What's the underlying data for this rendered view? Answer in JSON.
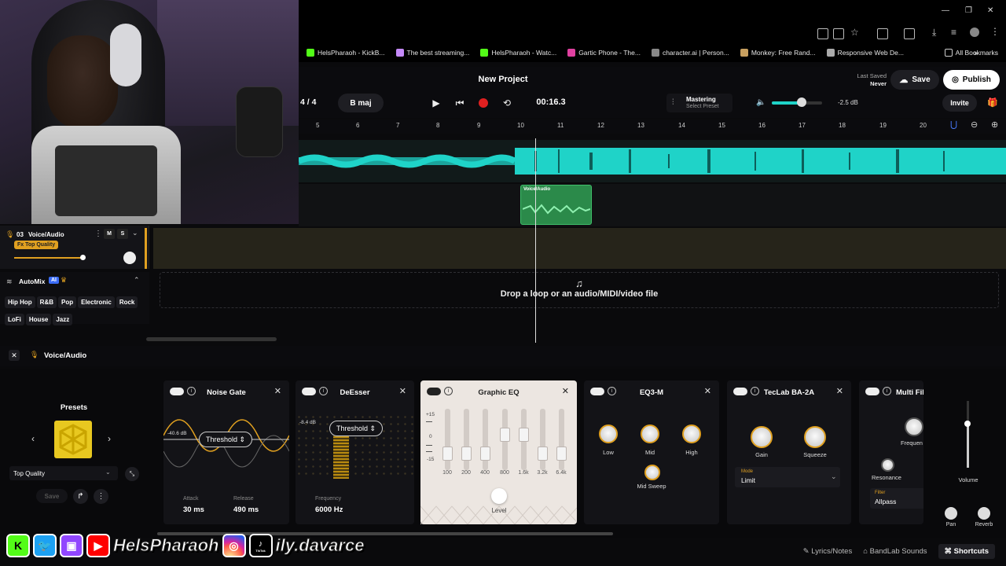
{
  "browser": {
    "bookmarks": [
      {
        "label": "HelsPharaoh - KickB...",
        "color": "#53fc18"
      },
      {
        "label": "The best streaming...",
        "color": "#c58af9"
      },
      {
        "label": "HelsPharaoh - Watc...",
        "color": "#53fc18"
      },
      {
        "label": "Gartic Phone - The...",
        "color": "#e040a0"
      },
      {
        "label": "character.ai | Person...",
        "color": "#888888"
      },
      {
        "label": "Monkey: Free Rand...",
        "color": "#c8a060"
      },
      {
        "label": "Responsive Web De...",
        "color": "#aaaaaa"
      }
    ],
    "all_bookmarks": "All Bookmarks"
  },
  "header": {
    "project_title": "New Project",
    "last_saved_label": "Last Saved",
    "last_saved_value": "Never",
    "save_label": "Save",
    "publish_label": "Publish",
    "invite_label": "Invite",
    "time_signature": "4 / 4",
    "key": "B maj",
    "time": "00:16.3",
    "mastering_label": "Mastering",
    "mastering_preset": "Select Preset",
    "volume_db": "-2.5 dB"
  },
  "ruler": [
    "5",
    "6",
    "7",
    "8",
    "9",
    "10",
    "11",
    "12",
    "13",
    "14",
    "15",
    "16",
    "17",
    "18",
    "19",
    "20"
  ],
  "track": {
    "number": "03",
    "name": "Voice/Audio",
    "mute": "M",
    "solo": "S",
    "fx_badge": "Fx Top Quality",
    "clip_label": "Voice/Audio"
  },
  "automix": {
    "title": "AutoMix",
    "ai_badge": "AI",
    "genres_row1": [
      "Hip Hop",
      "R&B",
      "Pop",
      "Electronic",
      "Rock"
    ],
    "genres_row2": [
      "LoFi",
      "House",
      "Jazz"
    ]
  },
  "drop_zone": "Drop a loop or an audio/MIDI/video file",
  "fx_panel": {
    "track_name": "Voice/Audio",
    "presets_title": "Presets",
    "preset_value": "Top Quality",
    "save_label": "Save",
    "noise_gate": {
      "title": "Noise Gate",
      "db": "-40.6 dB",
      "threshold": "Threshold",
      "attack_label": "Attack",
      "attack": "30 ms",
      "release_label": "Release",
      "release": "490 ms"
    },
    "deesser": {
      "title": "DeEsser",
      "db": "-8.4 dB",
      "threshold": "Threshold",
      "freq_label": "Frequency",
      "freq": "6000 Hz"
    },
    "graphic_eq": {
      "title": "Graphic EQ",
      "scale": [
        "+15",
        "0",
        "-15"
      ],
      "bands": [
        "100",
        "200",
        "400",
        "800",
        "1.6k",
        "3.2k",
        "6.4k"
      ],
      "band_levels": [
        0.2,
        0.2,
        0.2,
        0.6,
        0.6,
        0.2,
        0.2
      ],
      "level_label": "Level"
    },
    "eq3m": {
      "title": "EQ3-M",
      "low": "Low",
      "mid": "Mid",
      "high": "High",
      "mid_sweep": "Mid Sweep"
    },
    "teclab": {
      "title": "TecLab BA-2A",
      "gain": "Gain",
      "squeeze": "Squeeze",
      "mode_label": "Mode",
      "mode": "Limit"
    },
    "multi": {
      "title": "Multi Fil",
      "frequency": "Frequen",
      "resonance": "Resonance",
      "filter_label": "Filter",
      "filter": "Allpass"
    },
    "volume": "Volume",
    "pan": "Pan",
    "reverb": "Reverb"
  },
  "footer": {
    "lyrics": "Lyrics/Notes",
    "bandlab": "BandLab Sounds",
    "shortcuts": "Shortcuts"
  },
  "overlay": {
    "name1": "HelsPharaoh",
    "name2": "ily.davarce",
    "tiktok_label": "TikTok"
  },
  "colors": {
    "accent": "#e0a020",
    "wave": "#1fd3c8",
    "clip": "#2b8a4a",
    "record": "#e02020"
  }
}
